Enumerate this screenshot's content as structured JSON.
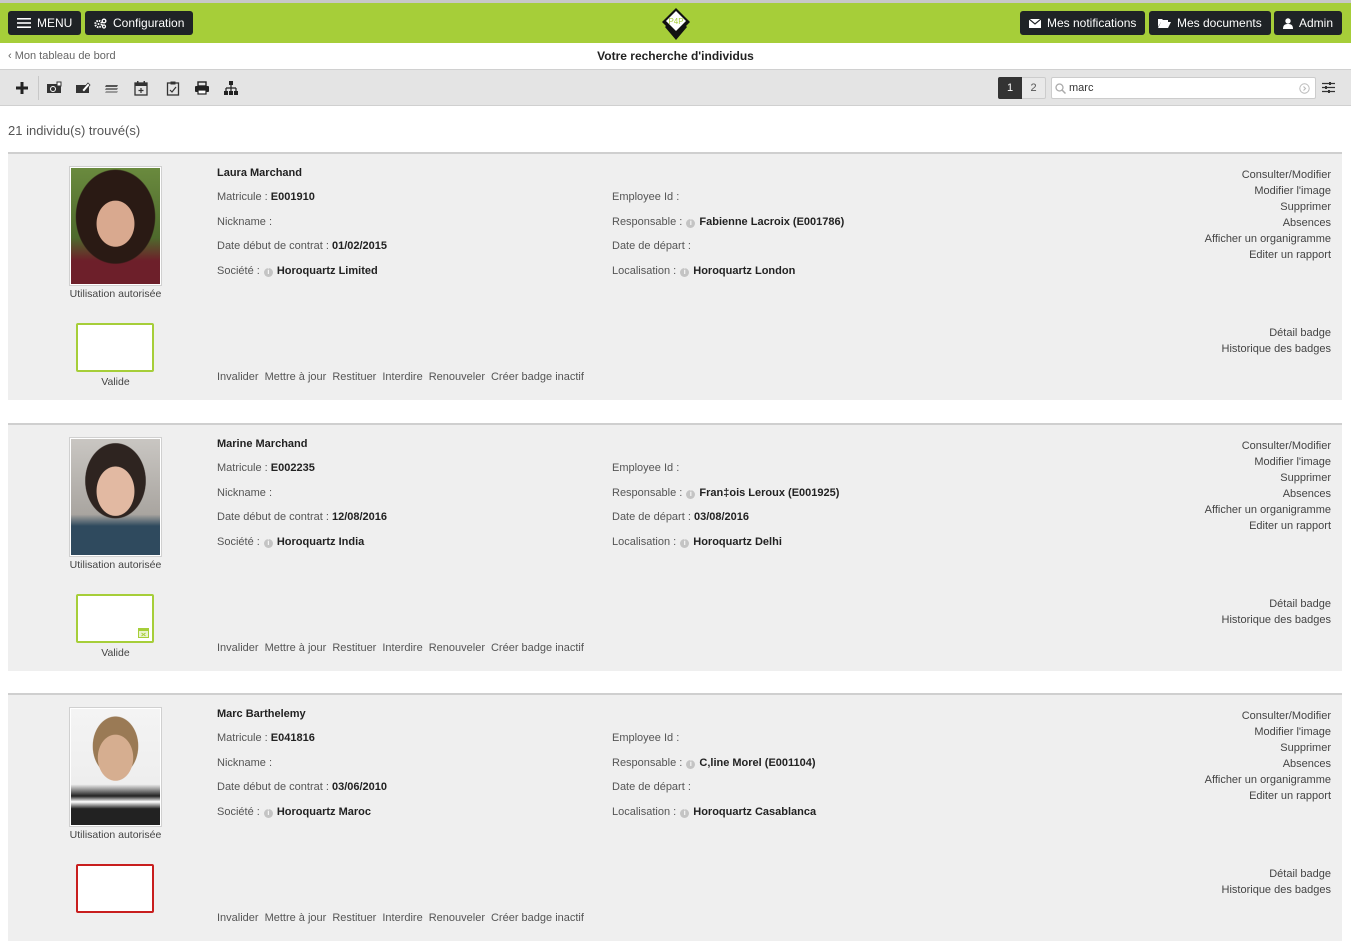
{
  "topbar": {
    "menu_label": "MENU",
    "config_label": "Configuration",
    "notifications_label": "Mes notifications",
    "documents_label": "Mes documents",
    "admin_label": "Admin",
    "logo_text": "P4P",
    "accent_color": "#a6ce39"
  },
  "subbar": {
    "back_label": "‹ Mon tableau de bord",
    "title": "Votre recherche d'individus"
  },
  "toolbar": {
    "icons": [
      "add-icon",
      "search-person-icon",
      "edit-card-icon",
      "stack-icon",
      "calendar-add-icon",
      "clipboard-check-icon",
      "print-icon",
      "org-chart-icon"
    ],
    "pages": [
      "1",
      "2"
    ],
    "active_page": "1",
    "search_value": "marc",
    "search_placeholder": ""
  },
  "results": {
    "count_label": "21 individu(s) trouvé(s)"
  },
  "labels": {
    "matricule": "Matricule : ",
    "employee_id": "Employee Id : ",
    "nickname": "Nickname : ",
    "responsable": "Responsable : ",
    "date_debut": "Date début de contrat : ",
    "date_depart": "Date de départ : ",
    "societe": "Société : ",
    "localisation": "Localisation : ",
    "usage": "Utilisation autorisée",
    "badge_status": "Valide"
  },
  "actions": [
    "Consulter/Modifier",
    "Modifier l'image",
    "Supprimer",
    "Absences",
    "Afficher un organigramme",
    "Editer un rapport"
  ],
  "badge_actions": [
    "Détail badge",
    "Historique des badges"
  ],
  "badge_links": [
    "Invalider",
    "Mettre à jour",
    "Restituer",
    "Interdire",
    "Renouveler",
    "Créer badge inactif"
  ],
  "people": [
    {
      "name": "Laura Marchand",
      "matricule": "E001910",
      "employee_id": "",
      "nickname": "",
      "responsable": "Fabienne Lacroix (E001786)",
      "date_debut": "01/02/2015",
      "date_depart": "",
      "societe": "Horoquartz Limited",
      "localisation": "Horoquartz London",
      "badge_status": "Valide",
      "badge_color": "#a6ce39"
    },
    {
      "name": "Marine Marchand",
      "matricule": "E002235",
      "employee_id": "",
      "nickname": "",
      "responsable": "Fran‡ois Leroux (E001925)",
      "date_debut": "12/08/2016",
      "date_depart": "03/08/2016",
      "societe": "Horoquartz India",
      "localisation": "Horoquartz Delhi",
      "badge_status": "Valide",
      "badge_color": "#a6ce39"
    },
    {
      "name": "Marc Barthelemy",
      "matricule": "E041816",
      "employee_id": "",
      "nickname": "",
      "responsable": "C‚line Morel (E001104)",
      "date_debut": "03/06/2010",
      "date_depart": "",
      "societe": "Horoquartz Maroc",
      "localisation": "Horoquartz Casablanca",
      "badge_status": "",
      "badge_color": "#c81e1e"
    }
  ]
}
